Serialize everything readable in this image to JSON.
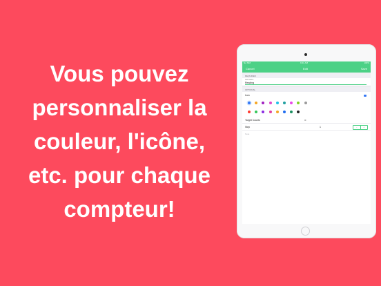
{
  "headline": {
    "lines": [
      "Vous pouvez",
      "personnaliser la",
      "couleur, l'icône,",
      "etc. pour chaque",
      "compteur!"
    ]
  },
  "device": {
    "status_bar": {
      "left": "No SIM",
      "center": "9:41 AM",
      "right": "100%"
    },
    "nav": {
      "cancel": "Cancel",
      "title": "Edit",
      "save": "Save"
    },
    "required_header": "REQUIRED",
    "name_field": {
      "caption": "Item Name",
      "value": "Reading"
    },
    "optional_header": "OPTIONAL",
    "icon_label": "Icon",
    "colors_row1": [
      "#3478f6",
      "#f5a623",
      "#a020c0",
      "#e048c8",
      "#1ec0e8",
      "#20a0a0",
      "#e848e8",
      "#7ed321",
      "#9b9b9b"
    ],
    "colors_row2": [
      "#ff3b30",
      "#34c759",
      "#8b2be2",
      "#e040a0",
      "#f5a623",
      "#1e6cf0",
      "#1a8f60",
      "#222222"
    ],
    "target_counts": {
      "label": "Target Counts",
      "value": "∞"
    },
    "step": {
      "label": "Step",
      "value": "1",
      "minus": "−",
      "plus": "+"
    },
    "note_placeholder": "Note",
    "accent": "#4cd186"
  },
  "background_color": "#fd4a5d"
}
